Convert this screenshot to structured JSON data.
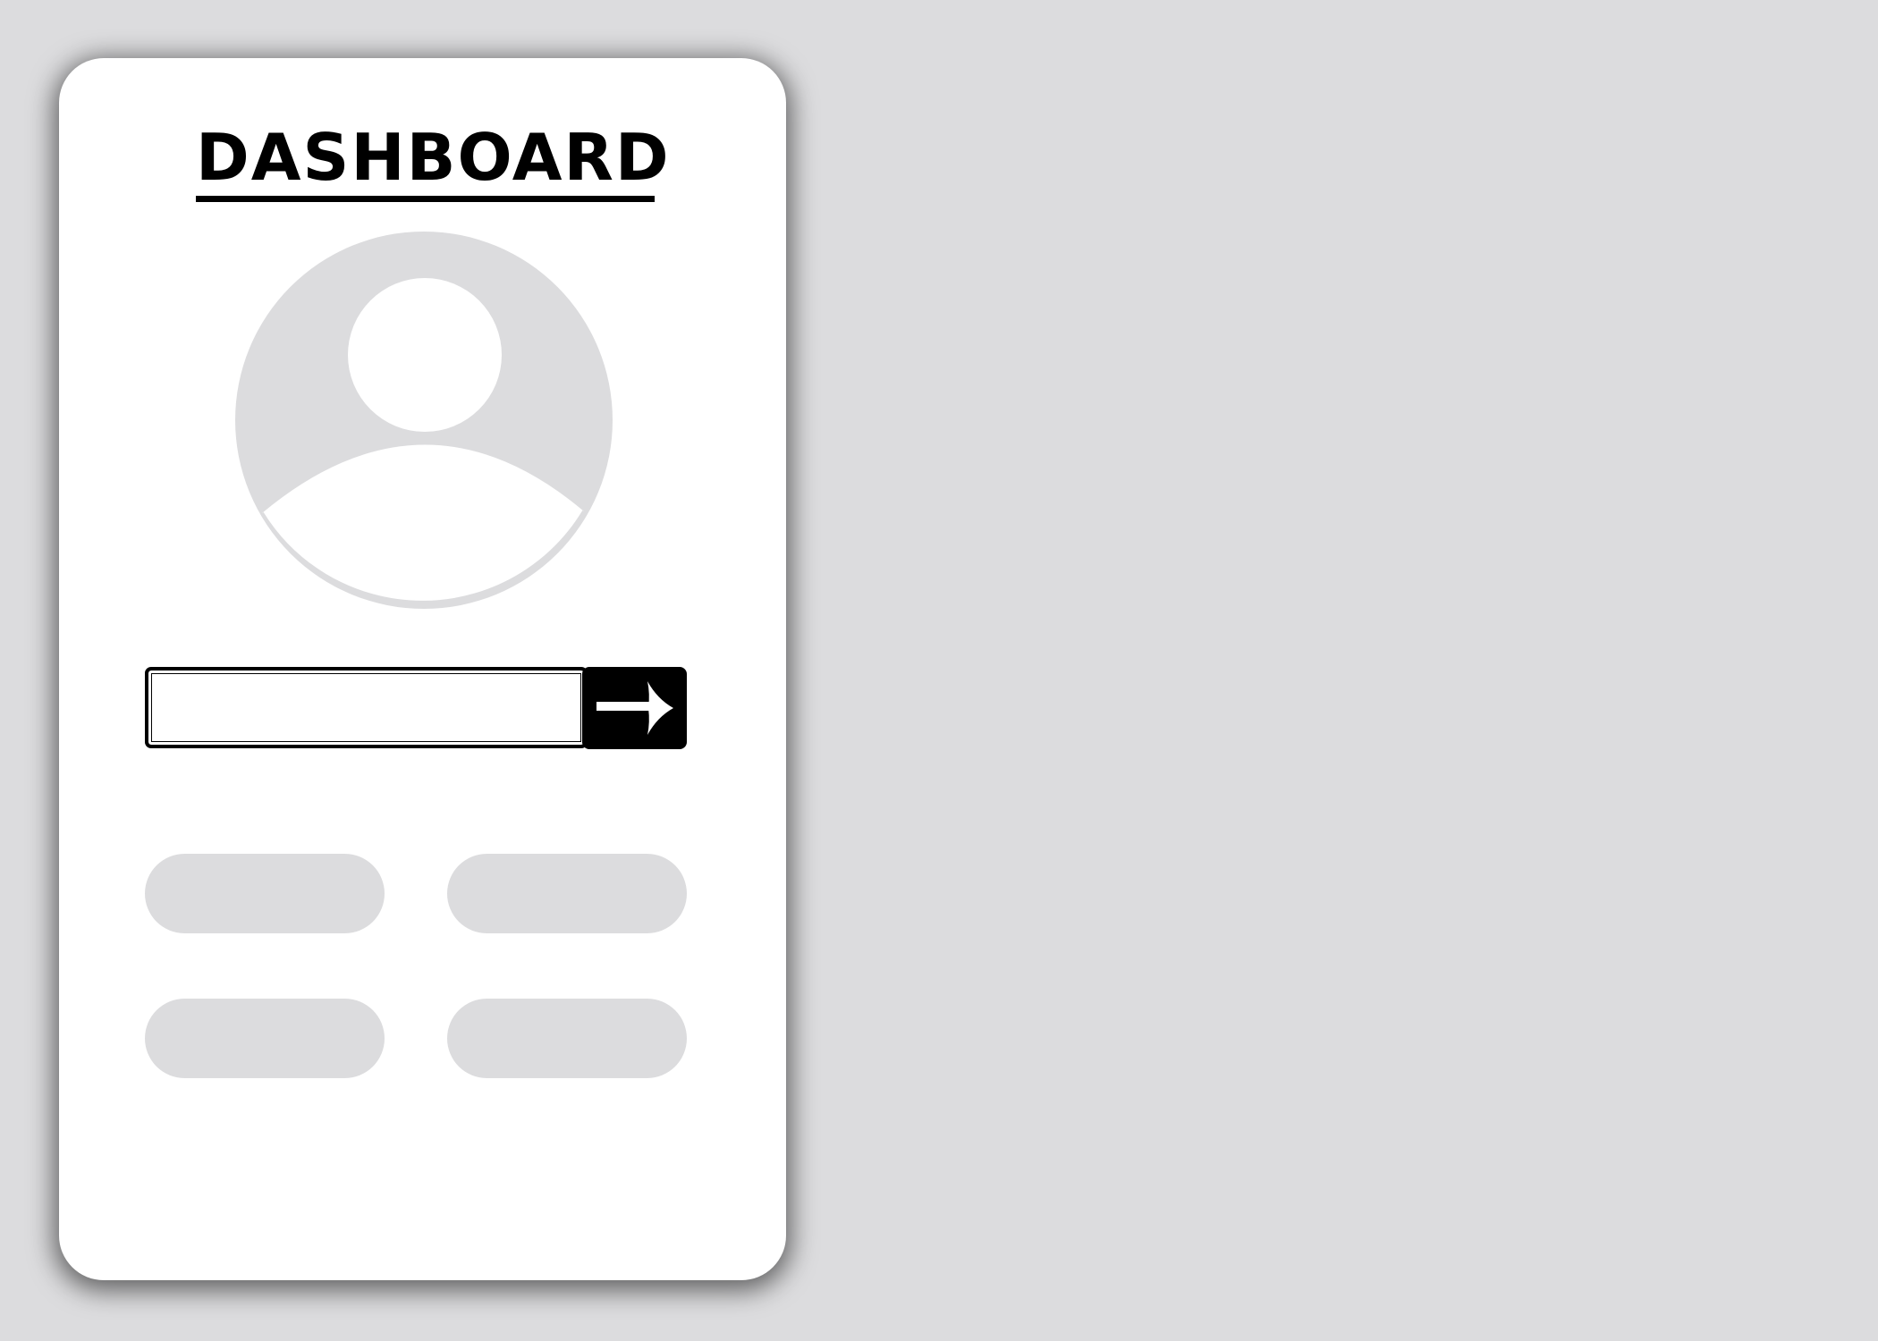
{
  "header": {
    "title": "DASHBOARD"
  },
  "avatar": {
    "icon": "user-avatar-icon"
  },
  "search": {
    "value": "",
    "placeholder": "",
    "submit_icon": "arrow-right-icon"
  },
  "menu": {
    "buttons": [
      {
        "label": ""
      },
      {
        "label": ""
      },
      {
        "label": ""
      },
      {
        "label": ""
      }
    ]
  },
  "colors": {
    "background": "#dcdcde",
    "card": "#ffffff",
    "accent": "#000000",
    "placeholder_gray": "#dcdcde"
  }
}
